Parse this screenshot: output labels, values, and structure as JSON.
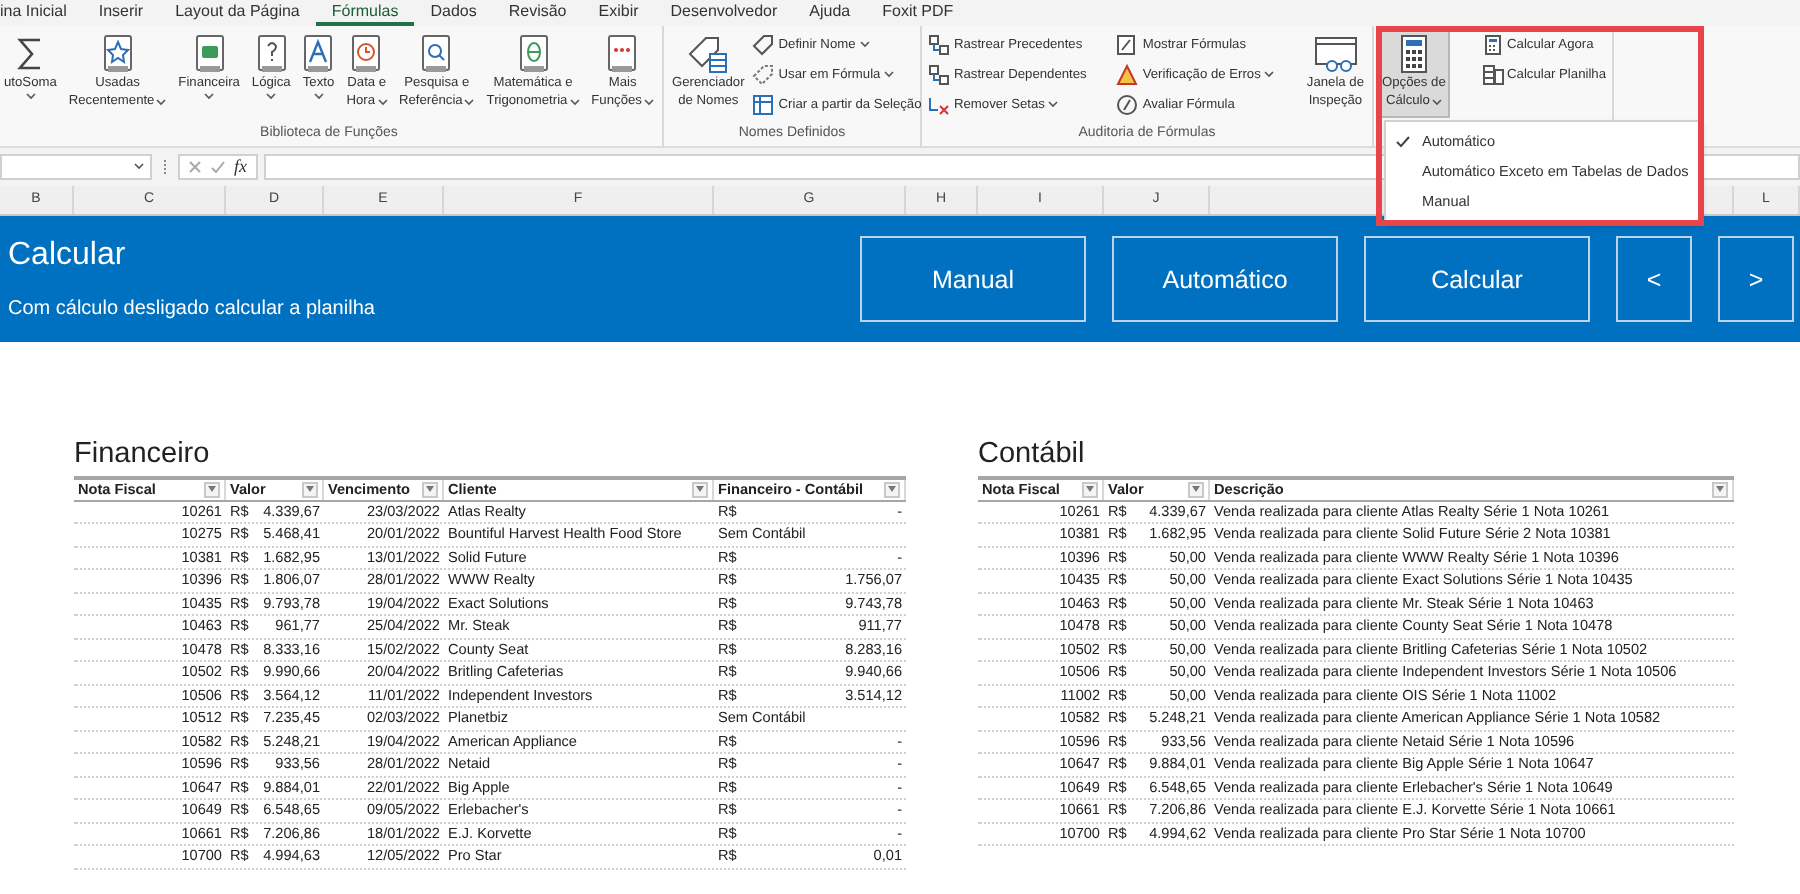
{
  "ribbon_tabs": [
    {
      "label": "ina Inicial",
      "selected": false
    },
    {
      "label": "Inserir",
      "selected": false
    },
    {
      "label": "Layout da Página",
      "selected": false
    },
    {
      "label": "Fórmulas",
      "selected": true
    },
    {
      "label": "Dados",
      "selected": false
    },
    {
      "label": "Revisão",
      "selected": false
    },
    {
      "label": "Exibir",
      "selected": false
    },
    {
      "label": "Desenvolvedor",
      "selected": false
    },
    {
      "label": "Ajuda",
      "selected": false
    },
    {
      "label": "Foxit PDF",
      "selected": false
    }
  ],
  "ribbon_groups": [
    {
      "title": "Biblioteca de Funções",
      "items": [
        {
          "kind": "large",
          "lines": [
            "utoSoma"
          ],
          "menu": true,
          "open": false
        },
        {
          "kind": "large",
          "lines": [
            "Usadas",
            "Recentemente"
          ],
          "menu": true,
          "open": false
        },
        {
          "kind": "large",
          "lines": [
            "Financeira"
          ],
          "menu": true,
          "open": false
        },
        {
          "kind": "large",
          "lines": [
            "Lógica"
          ],
          "menu": true,
          "open": false
        },
        {
          "kind": "large",
          "lines": [
            "Texto"
          ],
          "menu": true,
          "open": false
        },
        {
          "kind": "large",
          "lines": [
            "Data e",
            "Hora"
          ],
          "menu": true,
          "open": false
        },
        {
          "kind": "large",
          "lines": [
            "Pesquisa e",
            "Referência"
          ],
          "menu": true,
          "open": false
        },
        {
          "kind": "large",
          "lines": [
            "Matemática e",
            "Trigonometria"
          ],
          "menu": true,
          "open": false
        },
        {
          "kind": "large",
          "lines": [
            "Mais",
            "Funções"
          ],
          "menu": true,
          "open": false
        }
      ]
    },
    {
      "title": "Nomes Definidos",
      "items": [
        {
          "kind": "large",
          "lines": [
            "Gerenciador",
            "de Nomes"
          ],
          "menu": false,
          "open": false
        },
        {
          "kind": "stack",
          "items": [
            {
              "label": "Definir Nome",
              "menu": true
            },
            {
              "label": "Usar em Fórmula",
              "menu": true
            },
            {
              "label": "Criar a partir da Seleção",
              "menu": false
            }
          ]
        }
      ]
    },
    {
      "title": "Auditoria de Fórmulas",
      "items": [
        {
          "kind": "stack",
          "items": [
            {
              "label": "Rastrear Precedentes",
              "menu": false
            },
            {
              "label": "Rastrear Dependentes",
              "menu": false
            },
            {
              "label": "Remover Setas",
              "menu": true
            }
          ]
        },
        {
          "kind": "stack",
          "items": [
            {
              "label": "Mostrar Fórmulas",
              "menu": false
            },
            {
              "label": "Verificação de Erros",
              "menu": true
            },
            {
              "label": "Avaliar Fórmula",
              "menu": false
            }
          ]
        },
        {
          "kind": "large",
          "lines": [
            "Janela de",
            "Inspeção"
          ],
          "menu": false,
          "open": false
        }
      ]
    },
    {
      "items": [
        {
          "kind": "large",
          "lines": [
            "Opções de",
            "Cálculo"
          ],
          "menu": true,
          "open": true
        },
        {
          "kind": "stack",
          "items": [
            {
              "label": "Calcular Agora",
              "menu": false
            },
            {
              "label": "Calcular Planilha",
              "menu": false
            }
          ]
        }
      ]
    }
  ],
  "calc_menu": {
    "items": [
      {
        "label": "Automático",
        "selected": true
      },
      {
        "label": "Automático Exceto em Tabelas de Dados",
        "selected": false
      },
      {
        "label": "Manual",
        "selected": false
      }
    ]
  },
  "formula_bar": {
    "function_label": "fx"
  },
  "column_headers": [
    "B",
    "C",
    "D",
    "E",
    "F",
    "G",
    "H",
    "I",
    "J",
    "L"
  ],
  "banner": {
    "title": "Calcular",
    "subtitle": "Com cálculo desligado calcular a planilha",
    "buttons": [
      {
        "label": "Manual",
        "kind": "wide"
      },
      {
        "label": "Automático",
        "kind": "wide"
      },
      {
        "label": "Calcular",
        "kind": "wide"
      },
      {
        "label": "<",
        "kind": "narrow"
      },
      {
        "label": ">",
        "kind": "narrow"
      }
    ]
  },
  "financeiro": {
    "title": "Financeiro",
    "columns": [
      "Nota Fiscal",
      "Valor",
      "Vencimento",
      "Cliente",
      "Financeiro - Contábil"
    ],
    "rows": [
      {
        "nota_fiscal": "10261",
        "valor": {
          "symbol": "R$",
          "amount": "4.339,67"
        },
        "vencimento": "23/03/2022",
        "cliente": "Atlas Realty",
        "financeiro_contabil": {
          "kind": "currency",
          "symbol": "R$",
          "amount": "-"
        }
      },
      {
        "nota_fiscal": "10275",
        "valor": {
          "symbol": "R$",
          "amount": "5.468,41"
        },
        "vencimento": "20/01/2022",
        "cliente": "Bountiful Harvest Health Food Store",
        "financeiro_contabil": {
          "kind": "text",
          "text": "Sem Contábil"
        }
      },
      {
        "nota_fiscal": "10381",
        "valor": {
          "symbol": "R$",
          "amount": "1.682,95"
        },
        "vencimento": "13/01/2022",
        "cliente": "Solid Future",
        "financeiro_contabil": {
          "kind": "currency",
          "symbol": "R$",
          "amount": "-"
        }
      },
      {
        "nota_fiscal": "10396",
        "valor": {
          "symbol": "R$",
          "amount": "1.806,07"
        },
        "vencimento": "28/01/2022",
        "cliente": "WWW Realty",
        "financeiro_contabil": {
          "kind": "currency",
          "symbol": "R$",
          "amount": "1.756,07"
        }
      },
      {
        "nota_fiscal": "10435",
        "valor": {
          "symbol": "R$",
          "amount": "9.793,78"
        },
        "vencimento": "19/04/2022",
        "cliente": "Exact Solutions",
        "financeiro_contabil": {
          "kind": "currency",
          "symbol": "R$",
          "amount": "9.743,78"
        }
      },
      {
        "nota_fiscal": "10463",
        "valor": {
          "symbol": "R$",
          "amount": "961,77"
        },
        "vencimento": "25/04/2022",
        "cliente": "Mr. Steak",
        "financeiro_contabil": {
          "kind": "currency",
          "symbol": "R$",
          "amount": "911,77"
        }
      },
      {
        "nota_fiscal": "10478",
        "valor": {
          "symbol": "R$",
          "amount": "8.333,16"
        },
        "vencimento": "15/02/2022",
        "cliente": "County Seat",
        "financeiro_contabil": {
          "kind": "currency",
          "symbol": "R$",
          "amount": "8.283,16"
        }
      },
      {
        "nota_fiscal": "10502",
        "valor": {
          "symbol": "R$",
          "amount": "9.990,66"
        },
        "vencimento": "20/04/2022",
        "cliente": "Britling Cafeterias",
        "financeiro_contabil": {
          "kind": "currency",
          "symbol": "R$",
          "amount": "9.940,66"
        }
      },
      {
        "nota_fiscal": "10506",
        "valor": {
          "symbol": "R$",
          "amount": "3.564,12"
        },
        "vencimento": "11/01/2022",
        "cliente": "Independent Investors",
        "financeiro_contabil": {
          "kind": "currency",
          "symbol": "R$",
          "amount": "3.514,12"
        }
      },
      {
        "nota_fiscal": "10512",
        "valor": {
          "symbol": "R$",
          "amount": "7.235,45"
        },
        "vencimento": "02/03/2022",
        "cliente": "Planetbiz",
        "financeiro_contabil": {
          "kind": "text",
          "text": "Sem Contábil"
        }
      },
      {
        "nota_fiscal": "10582",
        "valor": {
          "symbol": "R$",
          "amount": "5.248,21"
        },
        "vencimento": "19/04/2022",
        "cliente": "American Appliance",
        "financeiro_contabil": {
          "kind": "currency",
          "symbol": "R$",
          "amount": "-"
        }
      },
      {
        "nota_fiscal": "10596",
        "valor": {
          "symbol": "R$",
          "amount": "933,56"
        },
        "vencimento": "28/01/2022",
        "cliente": "Netaid",
        "financeiro_contabil": {
          "kind": "currency",
          "symbol": "R$",
          "amount": "-"
        }
      },
      {
        "nota_fiscal": "10647",
        "valor": {
          "symbol": "R$",
          "amount": "9.884,01"
        },
        "vencimento": "22/01/2022",
        "cliente": "Big Apple",
        "financeiro_contabil": {
          "kind": "currency",
          "symbol": "R$",
          "amount": "-"
        }
      },
      {
        "nota_fiscal": "10649",
        "valor": {
          "symbol": "R$",
          "amount": "6.548,65"
        },
        "vencimento": "09/05/2022",
        "cliente": "Erlebacher's",
        "financeiro_contabil": {
          "kind": "currency",
          "symbol": "R$",
          "amount": "-"
        }
      },
      {
        "nota_fiscal": "10661",
        "valor": {
          "symbol": "R$",
          "amount": "7.206,86"
        },
        "vencimento": "18/01/2022",
        "cliente": "E.J. Korvette",
        "financeiro_contabil": {
          "kind": "currency",
          "symbol": "R$",
          "amount": "-"
        }
      },
      {
        "nota_fiscal": "10700",
        "valor": {
          "symbol": "R$",
          "amount": "4.994,63"
        },
        "vencimento": "12/05/2022",
        "cliente": "Pro Star",
        "financeiro_contabil": {
          "kind": "currency",
          "symbol": "R$",
          "amount": "0,01"
        }
      }
    ]
  },
  "contabil": {
    "title": "Contábil",
    "columns": [
      "Nota Fiscal",
      "Valor",
      "Descrição"
    ],
    "rows": [
      {
        "nota_fiscal": "10261",
        "valor": {
          "symbol": "R$",
          "amount": "4.339,67"
        },
        "descricao": "Venda realizada para cliente Atlas Realty Série 1 Nota 10261"
      },
      {
        "nota_fiscal": "10381",
        "valor": {
          "symbol": "R$",
          "amount": "1.682,95"
        },
        "descricao": "Venda realizada para cliente Solid Future Série 2 Nota 10381"
      },
      {
        "nota_fiscal": "10396",
        "valor": {
          "symbol": "R$",
          "amount": "50,00"
        },
        "descricao": "Venda realizada para cliente WWW Realty Série 1 Nota 10396"
      },
      {
        "nota_fiscal": "10435",
        "valor": {
          "symbol": "R$",
          "amount": "50,00"
        },
        "descricao": "Venda realizada para cliente Exact Solutions Série 1 Nota 10435"
      },
      {
        "nota_fiscal": "10463",
        "valor": {
          "symbol": "R$",
          "amount": "50,00"
        },
        "descricao": "Venda realizada para cliente Mr. Steak Série 1 Nota 10463"
      },
      {
        "nota_fiscal": "10478",
        "valor": {
          "symbol": "R$",
          "amount": "50,00"
        },
        "descricao": "Venda realizada para cliente County Seat Série 1 Nota 10478"
      },
      {
        "nota_fiscal": "10502",
        "valor": {
          "symbol": "R$",
          "amount": "50,00"
        },
        "descricao": "Venda realizada para cliente Britling Cafeterias Série 1 Nota 10502"
      },
      {
        "nota_fiscal": "10506",
        "valor": {
          "symbol": "R$",
          "amount": "50,00"
        },
        "descricao": "Venda realizada para cliente Independent Investors Série 1 Nota 10506"
      },
      {
        "nota_fiscal": "11002",
        "valor": {
          "symbol": "R$",
          "amount": "50,00"
        },
        "descricao": "Venda realizada para cliente OIS Série 1 Nota 11002"
      },
      {
        "nota_fiscal": "10582",
        "valor": {
          "symbol": "R$",
          "amount": "5.248,21"
        },
        "descricao": "Venda realizada para cliente American Appliance Série 1 Nota 10582"
      },
      {
        "nota_fiscal": "10596",
        "valor": {
          "symbol": "R$",
          "amount": "933,56"
        },
        "descricao": "Venda realizada para cliente Netaid Série 1 Nota 10596"
      },
      {
        "nota_fiscal": "10647",
        "valor": {
          "symbol": "R$",
          "amount": "9.884,01"
        },
        "descricao": "Venda realizada para cliente Big Apple Série 1 Nota 10647"
      },
      {
        "nota_fiscal": "10649",
        "valor": {
          "symbol": "R$",
          "amount": "6.548,65"
        },
        "descricao": "Venda realizada para cliente Erlebacher's Série 1 Nota 10649"
      },
      {
        "nota_fiscal": "10661",
        "valor": {
          "symbol": "R$",
          "amount": "7.206,86"
        },
        "descricao": "Venda realizada para cliente E.J. Korvette Série 1 Nota 10661"
      },
      {
        "nota_fiscal": "10700",
        "valor": {
          "symbol": "R$",
          "amount": "4.994,62"
        },
        "descricao": "Venda realizada para cliente Pro Star Série 1 Nota 10700"
      }
    ]
  }
}
